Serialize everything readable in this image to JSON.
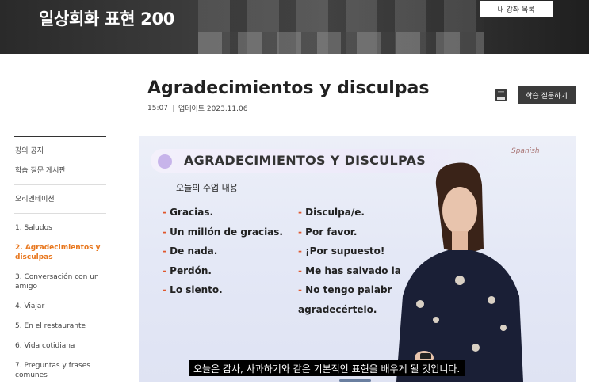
{
  "banner": {
    "course_title": "일상회화 표현 200",
    "my_courses_label": "내 강좌 목록"
  },
  "lesson": {
    "title": "Agradecimientos y disculpas",
    "duration": "15:07",
    "updated": "업데이트 2023.11.06",
    "qa_button_label": "학습 질문하기"
  },
  "sidebar": {
    "notice": "강의 공지",
    "qa_board": "학습 질문 게시판",
    "orientation": "오리엔테이션",
    "lessons": [
      {
        "label": "1. Saludos",
        "active": false
      },
      {
        "label": "2. Agradecimientos y disculpas",
        "active": true
      },
      {
        "label": "3. Conversación con un amigo",
        "active": false
      },
      {
        "label": "4. Viajar",
        "active": false
      },
      {
        "label": "5. En el restaurante",
        "active": false
      },
      {
        "label": "6. Vida cotidiana",
        "active": false
      },
      {
        "label": "7. Preguntas y frases comunes",
        "active": false
      }
    ]
  },
  "video": {
    "slide_title": "AGRADECIMIENTOS Y DISCULPAS",
    "slide_subtitle": "오늘의 수업 내용",
    "brand": "Spanish",
    "left_phrases": [
      "Gracias.",
      "Un millón de gracias.",
      "De nada.",
      "Perdón.",
      "Lo siento."
    ],
    "right_phrases": [
      "Disculpa/e.",
      "Por favor.",
      "¡Por supuesto!",
      "Me has salvado la",
      "No tengo palabr",
      "agradecértelo."
    ],
    "caption": "오늘은 감사, 사과하기와 같은 기본적인 표현을 배우게 될 것입니다."
  },
  "colors": {
    "accent_orange": "#e8771e",
    "dash_red": "#e0572d",
    "button_dark": "#3b3b3b"
  }
}
